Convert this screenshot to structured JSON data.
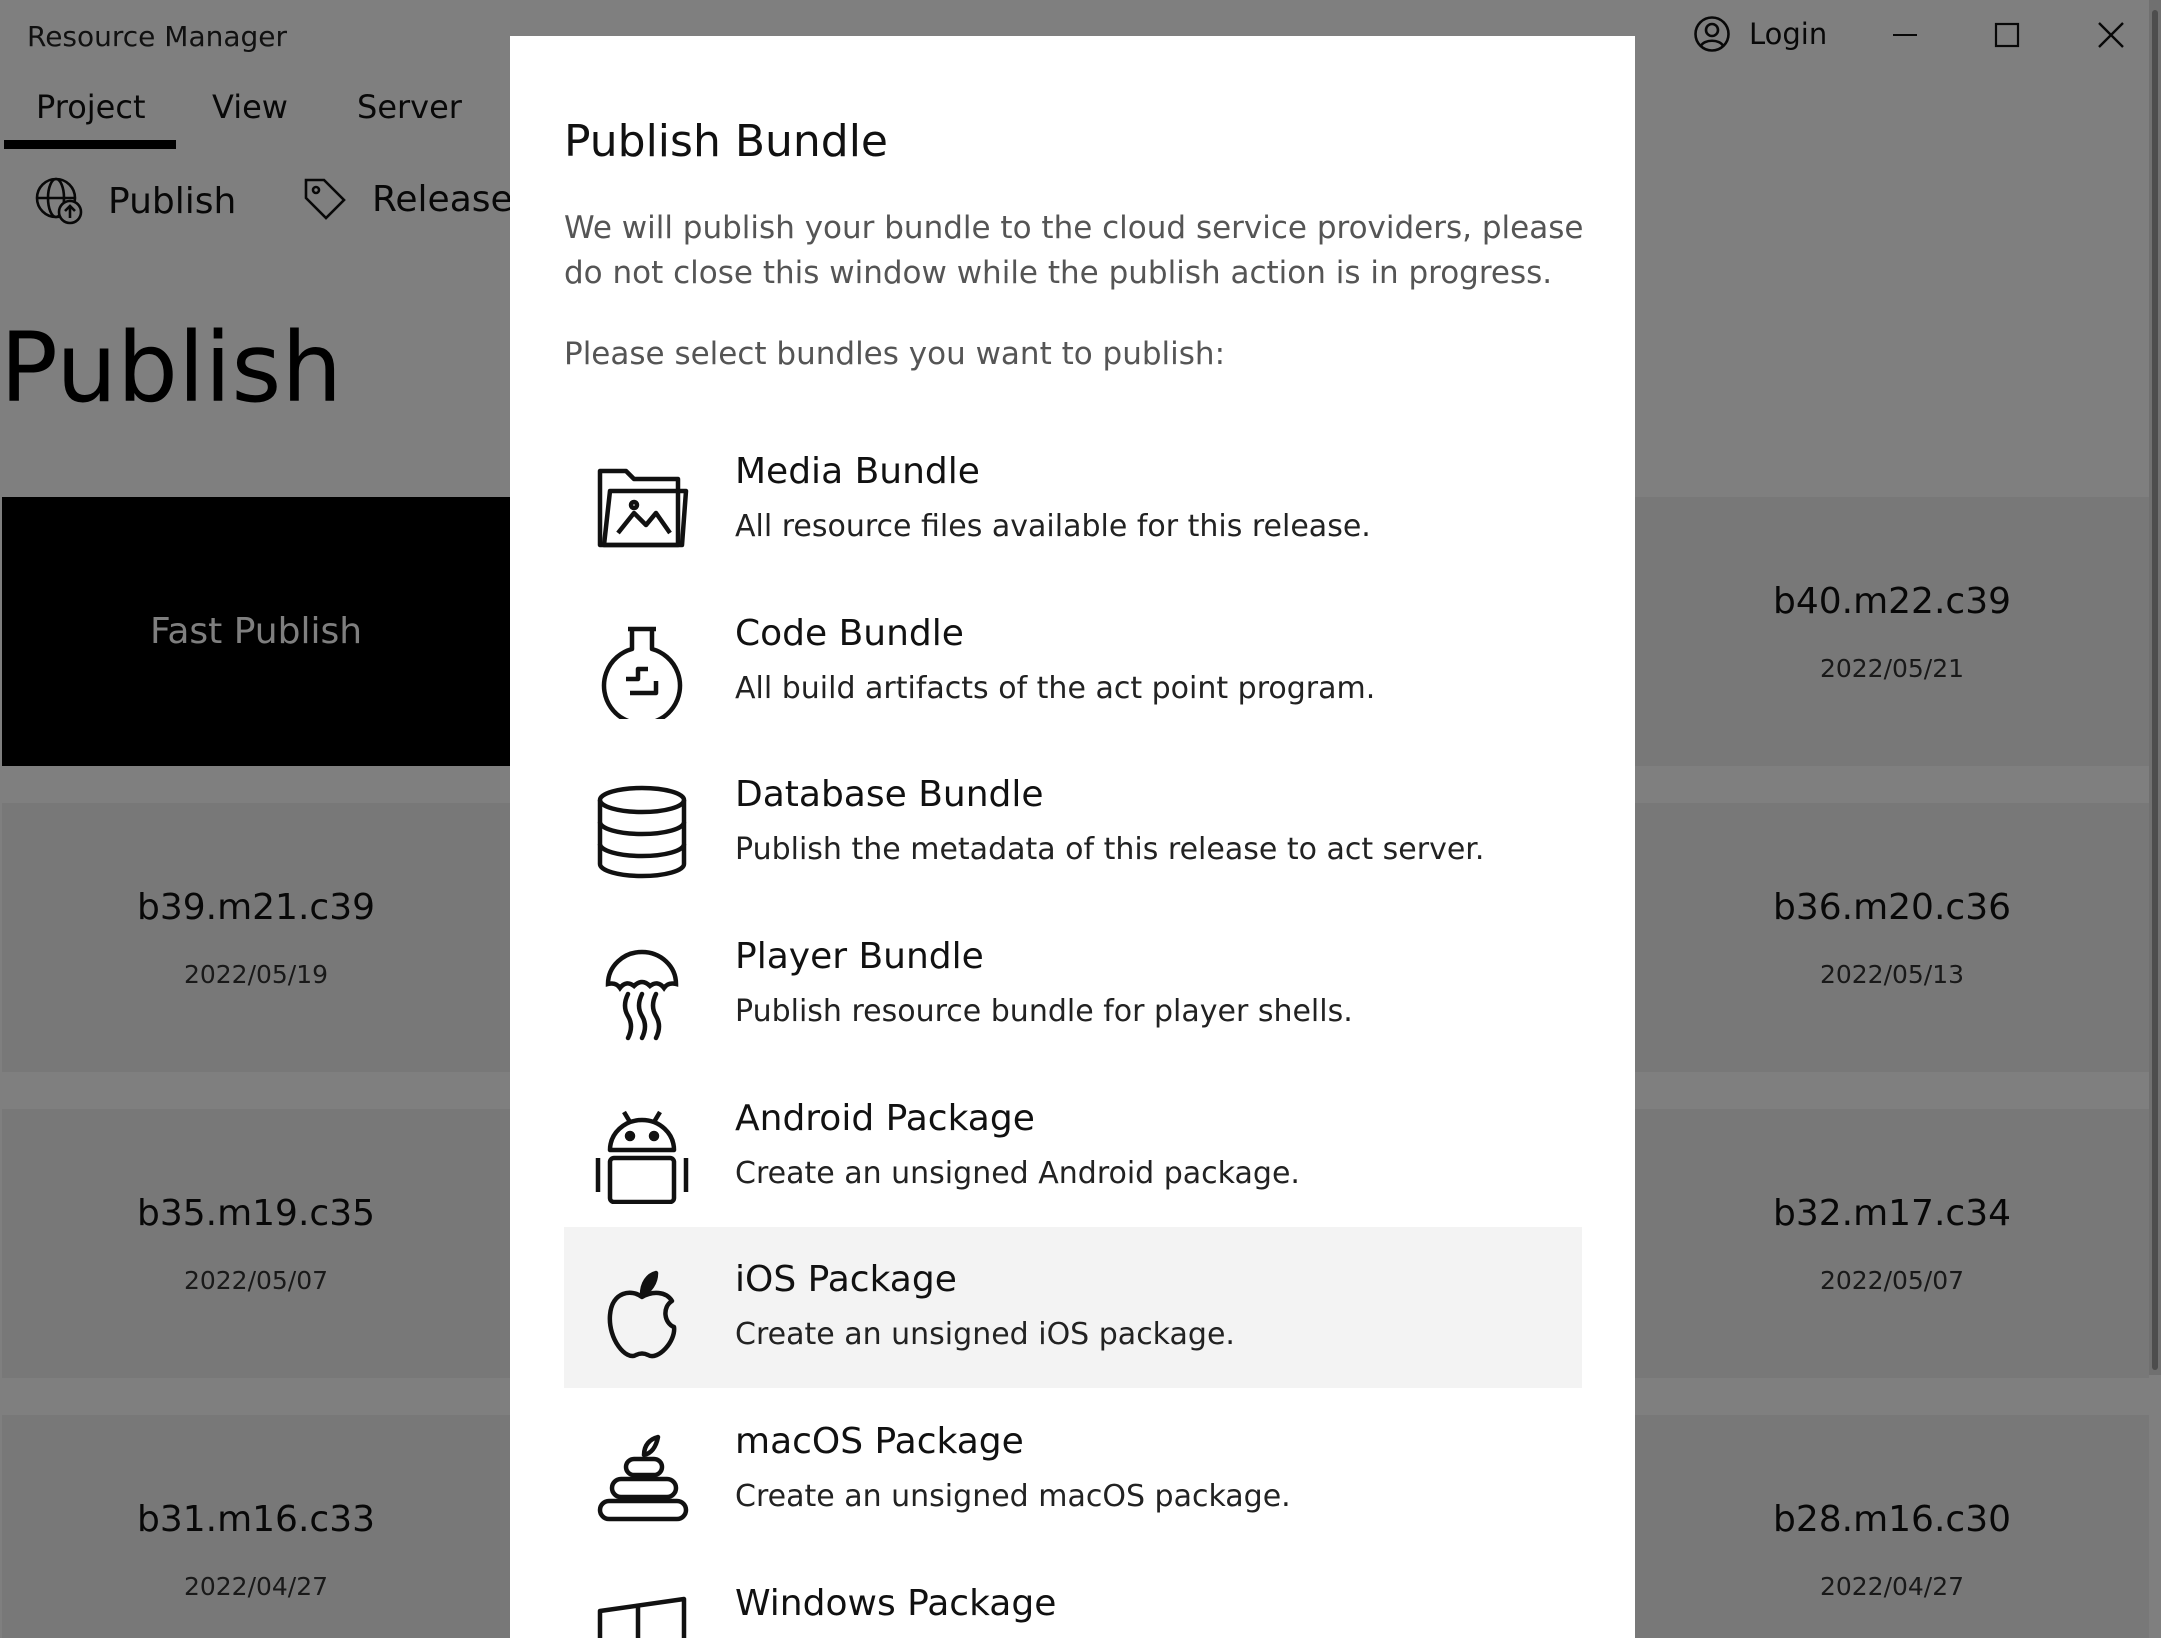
{
  "app": {
    "title": "Resource Manager",
    "login_label": "Login"
  },
  "tabs": [
    {
      "label": "Project"
    },
    {
      "label": "View"
    },
    {
      "label": "Server"
    }
  ],
  "toolbar": {
    "publish_label": "Publish",
    "release_label": "Release"
  },
  "page": {
    "title": "Publish"
  },
  "tiles": [
    {
      "name": "Fast Publish",
      "date": ""
    },
    {
      "name": "b40.m22.c39",
      "date": "2022/05/21"
    },
    {
      "name": "b39.m21.c39",
      "date": "2022/05/19"
    },
    {
      "name": "b36.m20.c36",
      "date": "2022/05/13"
    },
    {
      "name": "b35.m19.c35",
      "date": "2022/05/07"
    },
    {
      "name": "b32.m17.c34",
      "date": "2022/05/07"
    },
    {
      "name": "b31.m16.c33",
      "date": "2022/04/27"
    },
    {
      "name": "b28.m16.c30",
      "date": "2022/04/27"
    }
  ],
  "dialog": {
    "title": "Publish Bundle",
    "description": "We will publish your bundle to the cloud service providers, please do not close this window while the publish action is in progress.",
    "prompt": "Please select bundles you want to publish:",
    "bundles": [
      {
        "title": "Media Bundle",
        "desc": "All resource files available for this release.",
        "icon": "image-folder-icon"
      },
      {
        "title": "Code Bundle",
        "desc": "All build artifacts of the act point program.",
        "icon": "flask-icon"
      },
      {
        "title": "Database Bundle",
        "desc": "Publish the metadata of this release to act server.",
        "icon": "database-icon"
      },
      {
        "title": "Player Bundle",
        "desc": "Publish resource bundle for player shells.",
        "icon": "jellyfish-icon"
      },
      {
        "title": "Android Package",
        "desc": "Create an unsigned Android package.",
        "icon": "android-icon"
      },
      {
        "title": "iOS Package",
        "desc": "Create an unsigned iOS package.",
        "icon": "apple-icon"
      },
      {
        "title": "macOS Package",
        "desc": "Create an unsigned macOS package.",
        "icon": "stacked-apple-icon"
      },
      {
        "title": "Windows Package",
        "desc": "",
        "icon": "windows-icon"
      }
    ]
  }
}
